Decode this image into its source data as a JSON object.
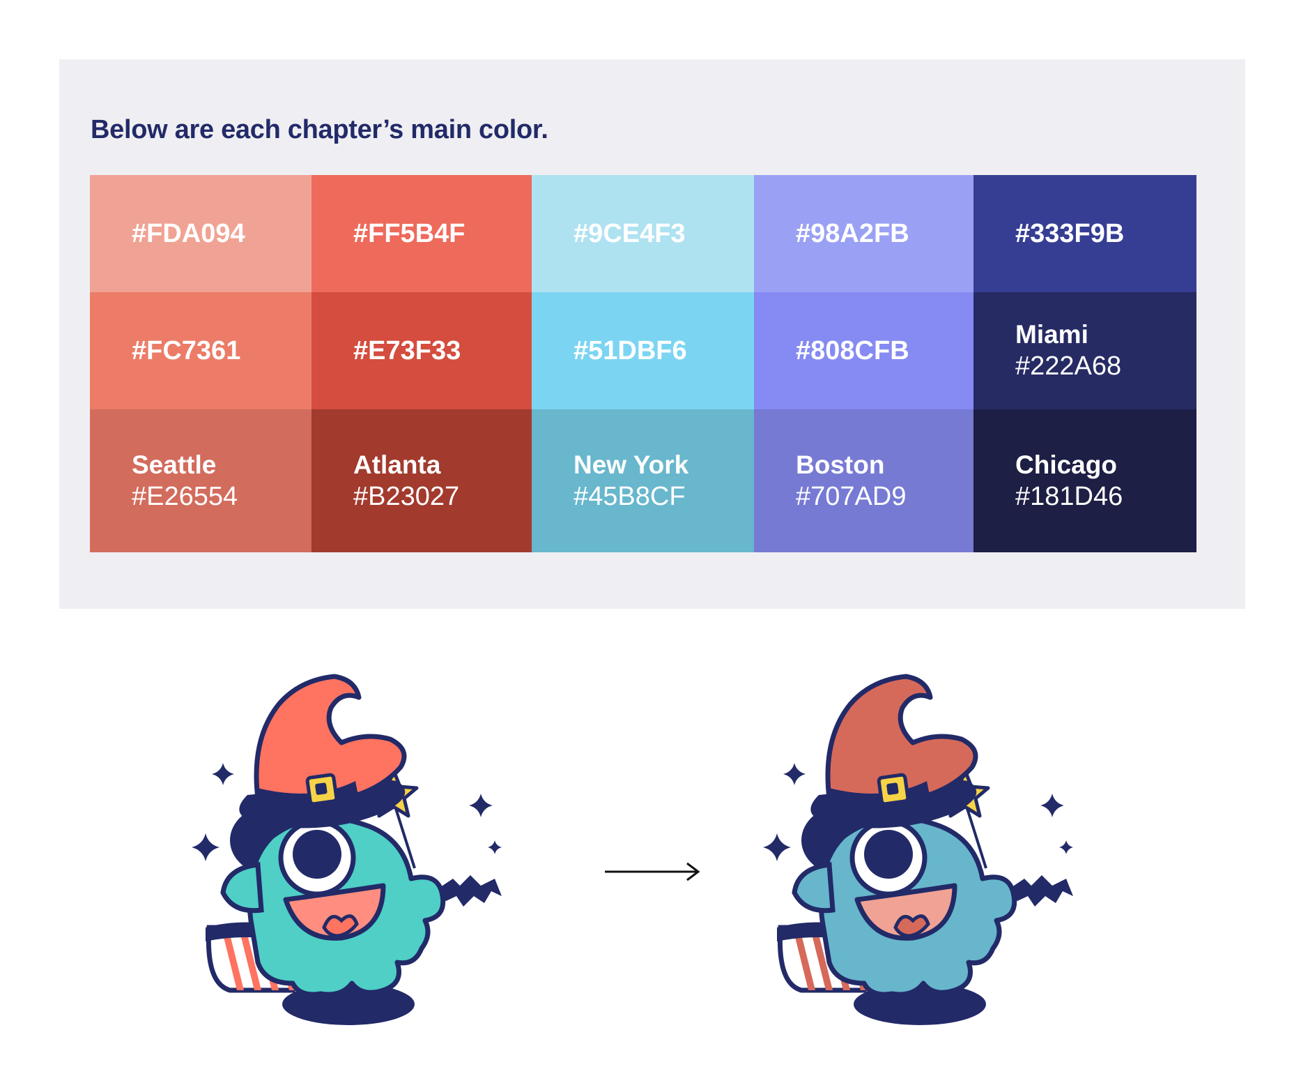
{
  "heading": "Below are each chapter’s main color.",
  "palette": {
    "rows": [
      [
        {
          "hex": "#FDA094",
          "fill": "#F0A394"
        },
        {
          "hex": "#FF5B4F",
          "fill": "#EE6A5B"
        },
        {
          "hex": "#9CE4F3",
          "fill": "#AFE2F1"
        },
        {
          "hex": "#98A2FB",
          "fill": "#9AA1F4"
        },
        {
          "hex": "#333F9B",
          "fill": "#363E94"
        }
      ],
      [
        {
          "hex": "#FC7361",
          "fill": "#EC7C67"
        },
        {
          "hex": "#E73F33",
          "fill": "#D44D3E"
        },
        {
          "hex": "#51DBF6",
          "fill": "#7BD5F2"
        },
        {
          "hex": "#808CFB",
          "fill": "#858BF2"
        },
        {
          "city": "Miami",
          "hex": "#222A68",
          "fill": "#262B64"
        }
      ],
      [
        {
          "city": "Seattle",
          "hex": "#E26554",
          "fill": "#D26C5C"
        },
        {
          "city": "Atlanta",
          "hex": "#B23027",
          "fill": "#A23A2E"
        },
        {
          "city": "New York",
          "hex": "#45B8CF",
          "fill": "#68B7CC"
        },
        {
          "city": "Boston",
          "hex": "#707AD9",
          "fill": "#767AD3"
        },
        {
          "city": "Chicago",
          "hex": "#181D46",
          "fill": "#1D1F44"
        }
      ]
    ]
  },
  "illustrations": {
    "before": {
      "hat": "#FF7361",
      "body": "#4FCFC6",
      "mouth": "#FF8E80"
    },
    "after": {
      "hat": "#D66A5A",
      "body": "#67B6CC",
      "mouth": "#F0A394"
    },
    "outline": "#222A68",
    "accent": "#F7D347",
    "arrow_icon": "right-arrow-icon"
  }
}
